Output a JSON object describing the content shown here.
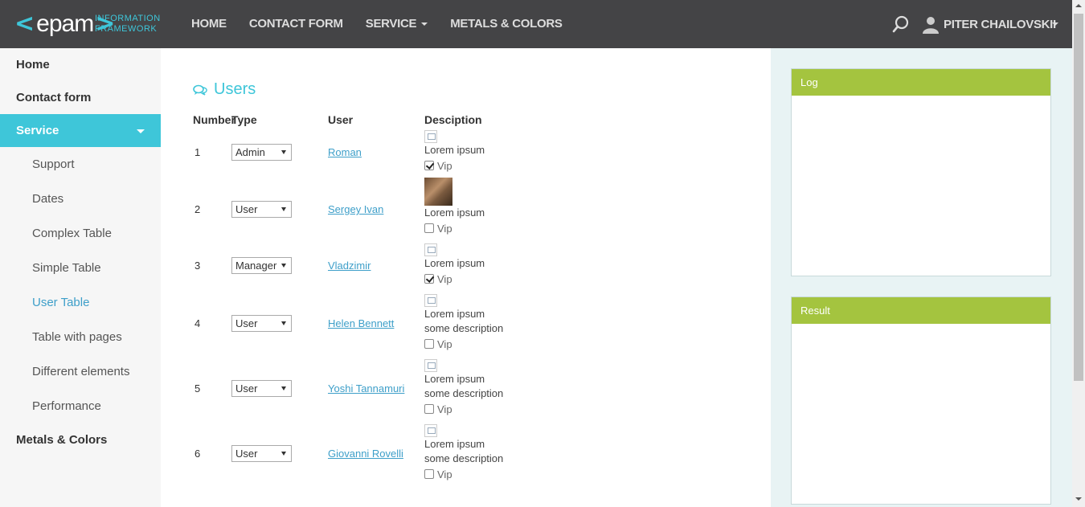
{
  "header": {
    "logo_text": "epam",
    "logo_sub_1": "INFORMATION",
    "logo_sub_2": "FRAMEWORK",
    "nav": [
      "HOME",
      "CONTACT FORM",
      "SERVICE",
      "METALS & COLORS"
    ],
    "user_name": "PITER CHAILOVSKII"
  },
  "sidebar": {
    "home": "Home",
    "contact": "Contact form",
    "service": "Service",
    "sub": [
      "Support",
      "Dates",
      "Complex Table",
      "Simple Table",
      "User Table",
      "Table with pages",
      "Different elements",
      "Performance"
    ],
    "metals": "Metals & Colors"
  },
  "main": {
    "title": "Users",
    "headers": {
      "number": "Number",
      "type": "Type",
      "user": "User",
      "description": "Desciption"
    },
    "rows": [
      {
        "num": "1",
        "type": "Admin",
        "user": "Roman",
        "desc1": "Lorem ipsum",
        "desc2": "",
        "vip": true
      },
      {
        "num": "2",
        "type": "User",
        "user": "Sergey Ivan",
        "desc1": "Lorem ipsum",
        "desc2": "",
        "vip": false
      },
      {
        "num": "3",
        "type": "Manager",
        "user": "Vladzimir",
        "desc1": "Lorem ipsum",
        "desc2": "",
        "vip": true
      },
      {
        "num": "4",
        "type": "User",
        "user": "Helen Bennett",
        "desc1": "Lorem ipsum",
        "desc2": "some description",
        "vip": false
      },
      {
        "num": "5",
        "type": "User",
        "user": "Yoshi Tannamuri",
        "desc1": "Lorem ipsum",
        "desc2": "some description",
        "vip": false
      },
      {
        "num": "6",
        "type": "User",
        "user": "Giovanni Rovelli",
        "desc1": "Lorem ipsum",
        "desc2": "some description",
        "vip": false
      }
    ],
    "vip_label": "Vip"
  },
  "right": {
    "log_title": "Log",
    "result_title": "Result"
  },
  "colors": {
    "accent": "#3ec6d9",
    "header_bg": "#444446",
    "panel_head": "#a4c43f"
  }
}
